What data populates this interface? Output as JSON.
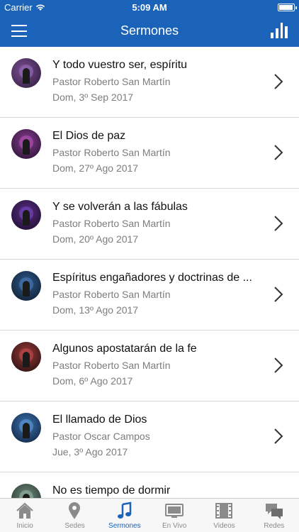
{
  "status_bar": {
    "carrier": "Carrier",
    "time": "5:09 AM"
  },
  "nav": {
    "title": "Sermones",
    "left_icon": "hamburger-menu-icon",
    "right_icon": "bar-chart-icon"
  },
  "sermons": [
    {
      "title": "Y todo vuestro ser, espíritu",
      "pastor": "Pastor Roberto San Martín",
      "date": "Dom, 3º Sep 2017"
    },
    {
      "title": "El Dios de paz",
      "pastor": "Pastor Roberto San Martín",
      "date": "Dom, 27º Ago 2017"
    },
    {
      "title": "Y se volverán a las fábulas",
      "pastor": "Pastor Roberto San Martín",
      "date": "Dom, 20º Ago 2017"
    },
    {
      "title": "Espíritus engañadores y doctrinas de ...",
      "pastor": "Pastor Roberto San Martín",
      "date": "Dom, 13º Ago 2017"
    },
    {
      "title": "Algunos apostatarán de la fe",
      "pastor": "Pastor Roberto San Martín",
      "date": "Dom, 6º Ago 2017"
    },
    {
      "title": "El llamado de Dios",
      "pastor": "Pastor Oscar Campos",
      "date": "Jue, 3º Ago 2017"
    },
    {
      "title": "No es tiempo de dormir",
      "pastor": "",
      "date": ""
    }
  ],
  "tabs": [
    {
      "label": "Inicio",
      "icon": "home-icon"
    },
    {
      "label": "Sedes",
      "icon": "location-pin-icon"
    },
    {
      "label": "Sermones",
      "icon": "music-note-icon",
      "active": true
    },
    {
      "label": "En Vivo",
      "icon": "tv-icon"
    },
    {
      "label": "Videos",
      "icon": "film-icon"
    },
    {
      "label": "Redes",
      "icon": "chat-bubbles-icon"
    }
  ],
  "colors": {
    "primary": "#1b63b8",
    "inactive": "#8a8a8a",
    "secondary_text": "#7d7d7d"
  }
}
